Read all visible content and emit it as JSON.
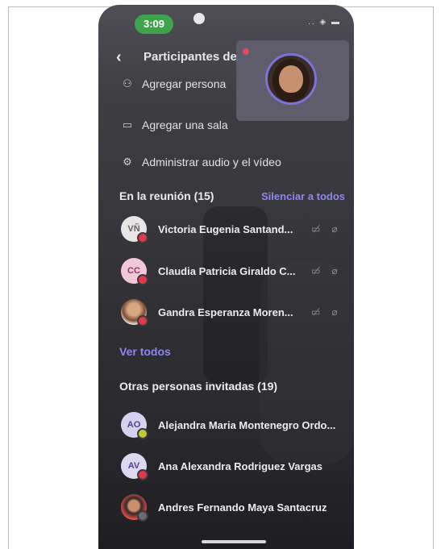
{
  "status_bar": {
    "time": "3:09",
    "icons": ".. ◈ ▬"
  },
  "header": {
    "back_icon": "chevron-left-icon",
    "title": "Participantes de"
  },
  "menu": [
    {
      "icon": "add-person-icon",
      "label": "Agregar persona"
    },
    {
      "icon": "room-icon",
      "label": "Agregar una sala"
    },
    {
      "icon": "gear-icon",
      "label": "Administrar audio y el vídeo"
    }
  ],
  "in_meeting": {
    "heading": "En la reunión (15)",
    "mute_all": "Silenciar a todos",
    "participants": [
      {
        "initials": "VÑ",
        "name": "Victoria Eugenia Santand...",
        "avatar_bg": "#e7e5e6",
        "avatar_fg": "#6a5f63",
        "badge": "#e0394b"
      },
      {
        "initials": "CC",
        "name": "Claudia Patricia Giraldo C...",
        "avatar_bg": "#f0c9d8",
        "avatar_fg": "#8b3a58",
        "badge": "#e0394b"
      },
      {
        "initials": "",
        "name": "Gandra Esperanza Moren...",
        "avatar_bg": "photo",
        "avatar_fg": "",
        "badge": "#e0394b"
      }
    ],
    "see_all": "Ver todos"
  },
  "invited": {
    "heading": "Otras personas invitadas (19)",
    "people": [
      {
        "initials": "AO",
        "name": "Alejandra Maria Montenegro Ordo...",
        "avatar_bg": "#d6d1ee",
        "avatar_fg": "#4b4393",
        "badge": "#c2c83a"
      },
      {
        "initials": "AV",
        "name": "Ana Alexandra Rodriguez Vargas",
        "avatar_bg": "#ddd9f1",
        "avatar_fg": "#4b4393",
        "badge": "#e0394b"
      },
      {
        "initials": "",
        "name": "Andres Fernando Maya Santacruz",
        "avatar_bg": "photo",
        "avatar_fg": "",
        "badge": "#6b6b70"
      }
    ]
  },
  "colors": {
    "accent": "#8f86f2",
    "background": "#3a3a3e"
  }
}
